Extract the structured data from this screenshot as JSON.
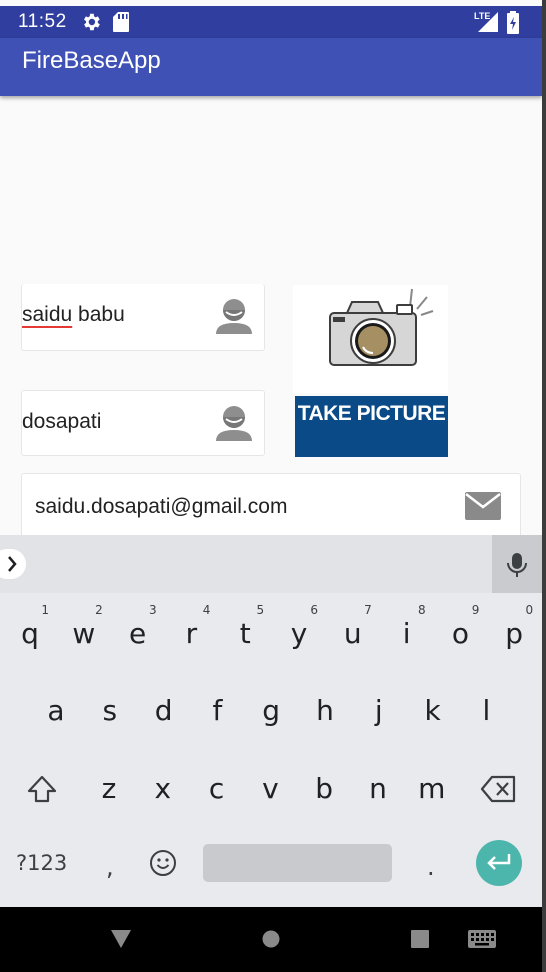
{
  "status_bar": {
    "time": "11:52",
    "network": "LTE",
    "icons": [
      "gear-icon",
      "sd-card-icon",
      "signal-icon",
      "battery-icon"
    ]
  },
  "app_bar": {
    "title": "FireBaseApp"
  },
  "form": {
    "first_name": {
      "misspelled": "saidu",
      "rest": " babu"
    },
    "last_name": "dosapati",
    "email": "saidu.dosapati@gmail.com",
    "take_picture_label": "TAKE PICTURE"
  },
  "keyboard": {
    "row1": [
      {
        "key": "q",
        "hint": "1"
      },
      {
        "key": "w",
        "hint": "2"
      },
      {
        "key": "e",
        "hint": "3"
      },
      {
        "key": "r",
        "hint": "4"
      },
      {
        "key": "t",
        "hint": "5"
      },
      {
        "key": "y",
        "hint": "6"
      },
      {
        "key": "u",
        "hint": "7"
      },
      {
        "key": "i",
        "hint": "8"
      },
      {
        "key": "o",
        "hint": "9"
      },
      {
        "key": "p",
        "hint": "0"
      }
    ],
    "row2": [
      "a",
      "s",
      "d",
      "f",
      "g",
      "h",
      "j",
      "k",
      "l"
    ],
    "row3": [
      "z",
      "x",
      "c",
      "v",
      "b",
      "n",
      "m"
    ],
    "symbols_label": "?123",
    "comma": ",",
    "period": "."
  },
  "colors": {
    "status_bar": "#303f9f",
    "app_bar": "#3f51b5",
    "take_picture_bg": "#0a4a86",
    "enter_key": "#4db6ac",
    "spell_underline": "#e53935"
  }
}
